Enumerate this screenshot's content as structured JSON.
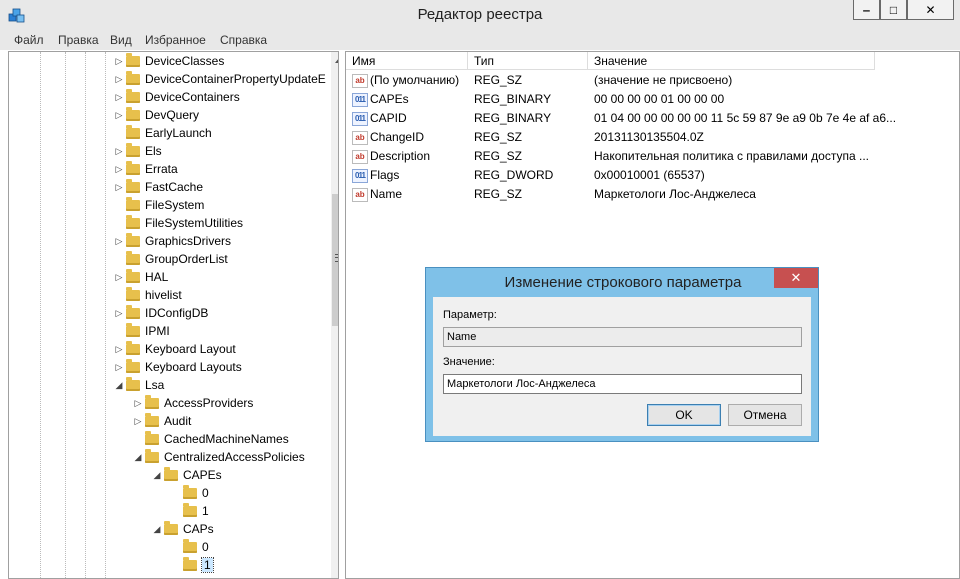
{
  "window": {
    "title": "Редактор реестра",
    "minimize": "‒",
    "maximize": "□",
    "close": "✕"
  },
  "menu": [
    "Файл",
    "Правка",
    "Вид",
    "Избранное",
    "Справка"
  ],
  "tree": [
    {
      "label": "DeviceClasses",
      "expander": "▷"
    },
    {
      "label": "DeviceContainerPropertyUpdateE",
      "expander": "▷"
    },
    {
      "label": "DeviceContainers",
      "expander": "▷"
    },
    {
      "label": "DevQuery",
      "expander": "▷"
    },
    {
      "label": "EarlyLaunch",
      "expander": ""
    },
    {
      "label": "Els",
      "expander": "▷"
    },
    {
      "label": "Errata",
      "expander": "▷"
    },
    {
      "label": "FastCache",
      "expander": "▷"
    },
    {
      "label": "FileSystem",
      "expander": ""
    },
    {
      "label": "FileSystemUtilities",
      "expander": ""
    },
    {
      "label": "GraphicsDrivers",
      "expander": "▷"
    },
    {
      "label": "GroupOrderList",
      "expander": ""
    },
    {
      "label": "HAL",
      "expander": "▷"
    },
    {
      "label": "hivelist",
      "expander": ""
    },
    {
      "label": "IDConfigDB",
      "expander": "▷"
    },
    {
      "label": "IPMI",
      "expander": ""
    },
    {
      "label": "Keyboard Layout",
      "expander": "▷"
    },
    {
      "label": "Keyboard Layouts",
      "expander": "▷"
    },
    {
      "label": "Lsa",
      "expander": "◢"
    },
    {
      "label": "AccessProviders",
      "expander": "▷"
    },
    {
      "label": "Audit",
      "expander": "▷"
    },
    {
      "label": "CachedMachineNames",
      "expander": ""
    },
    {
      "label": "CentralizedAccessPolicies",
      "expander": "◢"
    },
    {
      "label": "CAPEs",
      "expander": "◢"
    },
    {
      "label": "0",
      "expander": ""
    },
    {
      "label": "1",
      "expander": ""
    },
    {
      "label": "CAPs",
      "expander": "◢"
    },
    {
      "label": "0",
      "expander": ""
    },
    {
      "label": "1",
      "expander": ""
    }
  ],
  "list": {
    "headers": {
      "name": "Имя",
      "type": "Тип",
      "value": "Значение"
    },
    "rows": [
      {
        "icon": "ab",
        "name": "(По умолчанию)",
        "type": "REG_SZ",
        "value": "(значение не присвоено)"
      },
      {
        "icon": "bin",
        "name": "CAPEs",
        "type": "REG_BINARY",
        "value": "00 00 00 00 01 00 00 00"
      },
      {
        "icon": "bin",
        "name": "CAPID",
        "type": "REG_BINARY",
        "value": "01 04 00 00 00 00 00 11 5c 59 87 9e a9 0b 7e 4e af a6..."
      },
      {
        "icon": "ab",
        "name": "ChangeID",
        "type": "REG_SZ",
        "value": "20131130135504.0Z"
      },
      {
        "icon": "ab",
        "name": "Description",
        "type": "REG_SZ",
        "value": "Накопительная политика с правилами доступа ..."
      },
      {
        "icon": "bin",
        "name": "Flags",
        "type": "REG_DWORD",
        "value": "0x00010001 (65537)"
      },
      {
        "icon": "ab",
        "name": "Name",
        "type": "REG_SZ",
        "value": "Маркетологи Лос-Анджелеса"
      }
    ]
  },
  "dialog": {
    "title": "Изменение строкового параметра",
    "close": "✕",
    "param_label": "Параметр:",
    "param_value": "Name",
    "value_label": "Значение:",
    "value_value": "Маркетологи Лос-Анджелеса",
    "ok": "OK",
    "cancel": "Отмена"
  }
}
